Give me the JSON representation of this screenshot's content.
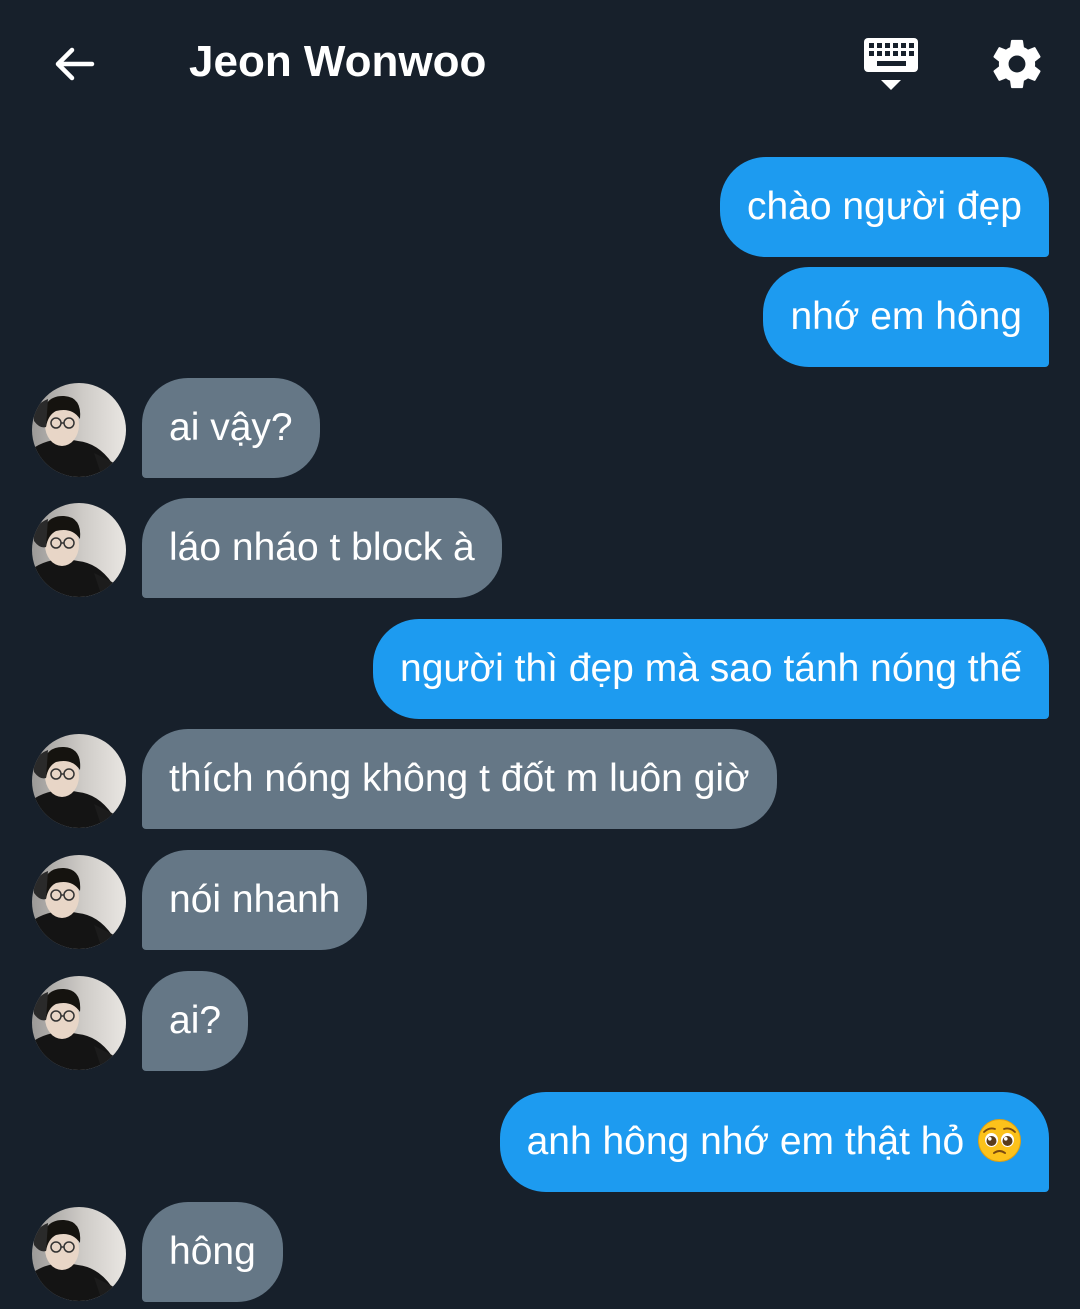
{
  "header": {
    "title": "Jeon Wonwoo",
    "back_icon": "arrow-left-icon",
    "keyboard_icon": "keyboard-icon",
    "settings_icon": "gear-icon"
  },
  "colors": {
    "background": "#17202b",
    "outgoing_bubble": "#1d9bf0",
    "incoming_bubble": "#657786"
  },
  "messages": [
    {
      "direction": "outgoing",
      "text": "chào người đẹp"
    },
    {
      "direction": "outgoing",
      "text": "nhớ em hông"
    },
    {
      "direction": "incoming",
      "text": "ai vậy?"
    },
    {
      "direction": "incoming",
      "text": "láo nháo t block à"
    },
    {
      "direction": "outgoing",
      "text": "người thì đẹp mà sao tánh nóng thế"
    },
    {
      "direction": "incoming",
      "text": "thích nóng không t đốt m luôn giờ"
    },
    {
      "direction": "incoming",
      "text": "nói nhanh"
    },
    {
      "direction": "incoming",
      "text": "ai?"
    },
    {
      "direction": "outgoing",
      "text": "anh hông nhớ em thật hỏ",
      "emoji": "pleading-face-emoji"
    },
    {
      "direction": "incoming",
      "text": "hông"
    }
  ]
}
